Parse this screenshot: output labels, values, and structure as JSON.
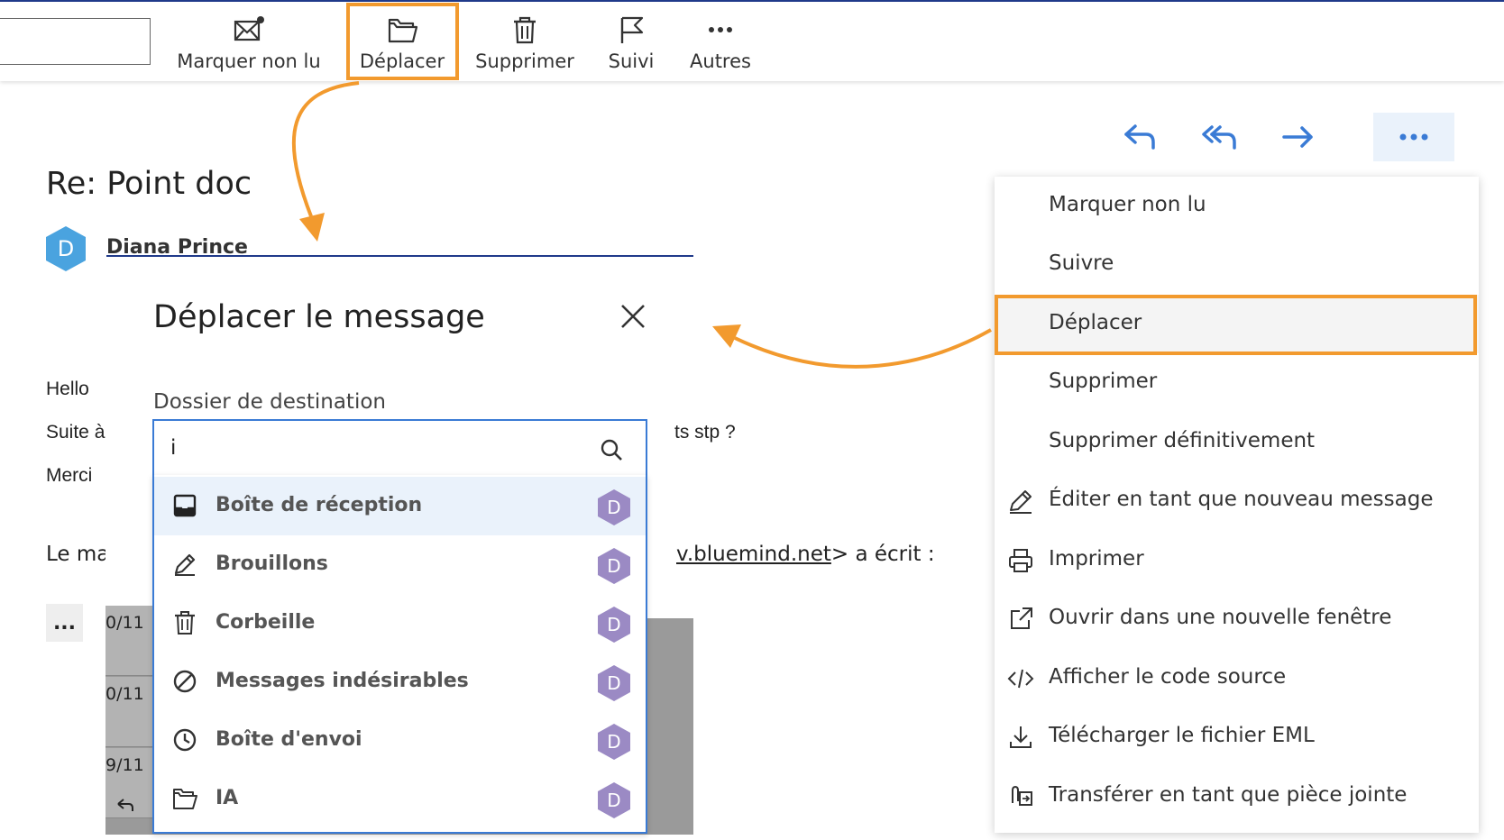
{
  "toolbar": {
    "mark_unread": "Marquer non lu",
    "move": "Déplacer",
    "delete": "Supprimer",
    "follow": "Suivi",
    "others": "Autres"
  },
  "message": {
    "subject": "Re: Point doc",
    "sender": "Diana Prince",
    "avatar_letter": "D",
    "line1": "Hello ",
    "line2": "Suite à",
    "line2_tail": "ts stp ?",
    "line3": "Merci",
    "line4": "Le ma",
    "line4_link": "v.bluemind.net",
    "line4_tail": "> a écrit :",
    "ellipsis": "...",
    "dates": [
      "0/11",
      "0/11",
      "9/11"
    ]
  },
  "move_dialog": {
    "title": "Déplacer le message",
    "dest_label": "Dossier de destination",
    "input_value": "i",
    "folders": [
      {
        "name": "Boîte de réception",
        "icon": "inbox-icon",
        "badge": "D"
      },
      {
        "name": "Brouillons",
        "icon": "pencil-icon",
        "badge": "D"
      },
      {
        "name": "Corbeille",
        "icon": "trash-icon",
        "badge": "D"
      },
      {
        "name": "Messages indésirables",
        "icon": "block-icon",
        "badge": "D"
      },
      {
        "name": "Boîte d'envoi",
        "icon": "clock-icon",
        "badge": "D"
      },
      {
        "name": "IA",
        "icon": "folder-icon",
        "badge": "D"
      }
    ]
  },
  "context_menu": {
    "items": [
      {
        "label": "Marquer non lu",
        "icon": ""
      },
      {
        "label": "Suivre",
        "icon": ""
      },
      {
        "label": "Déplacer",
        "icon": ""
      },
      {
        "label": "Supprimer",
        "icon": ""
      },
      {
        "label": "Supprimer définitivement",
        "icon": ""
      },
      {
        "label": "Éditer en tant que nouveau message",
        "icon": "pencil-icon"
      },
      {
        "label": "Imprimer",
        "icon": "printer-icon"
      },
      {
        "label": "Ouvrir dans une nouvelle fenêtre",
        "icon": "external-link-icon"
      },
      {
        "label": "Afficher le code source",
        "icon": "code-icon"
      },
      {
        "label": "Télécharger le fichier EML",
        "icon": "download-icon"
      },
      {
        "label": "Transférer en tant que pièce jointe",
        "icon": "attachment-forward-icon"
      }
    ]
  },
  "colors": {
    "accent": "#3a7bd5",
    "highlight": "#f29a2e",
    "avatar_sender": "#4aa3df",
    "avatar_folder": "#9b8ac4"
  }
}
